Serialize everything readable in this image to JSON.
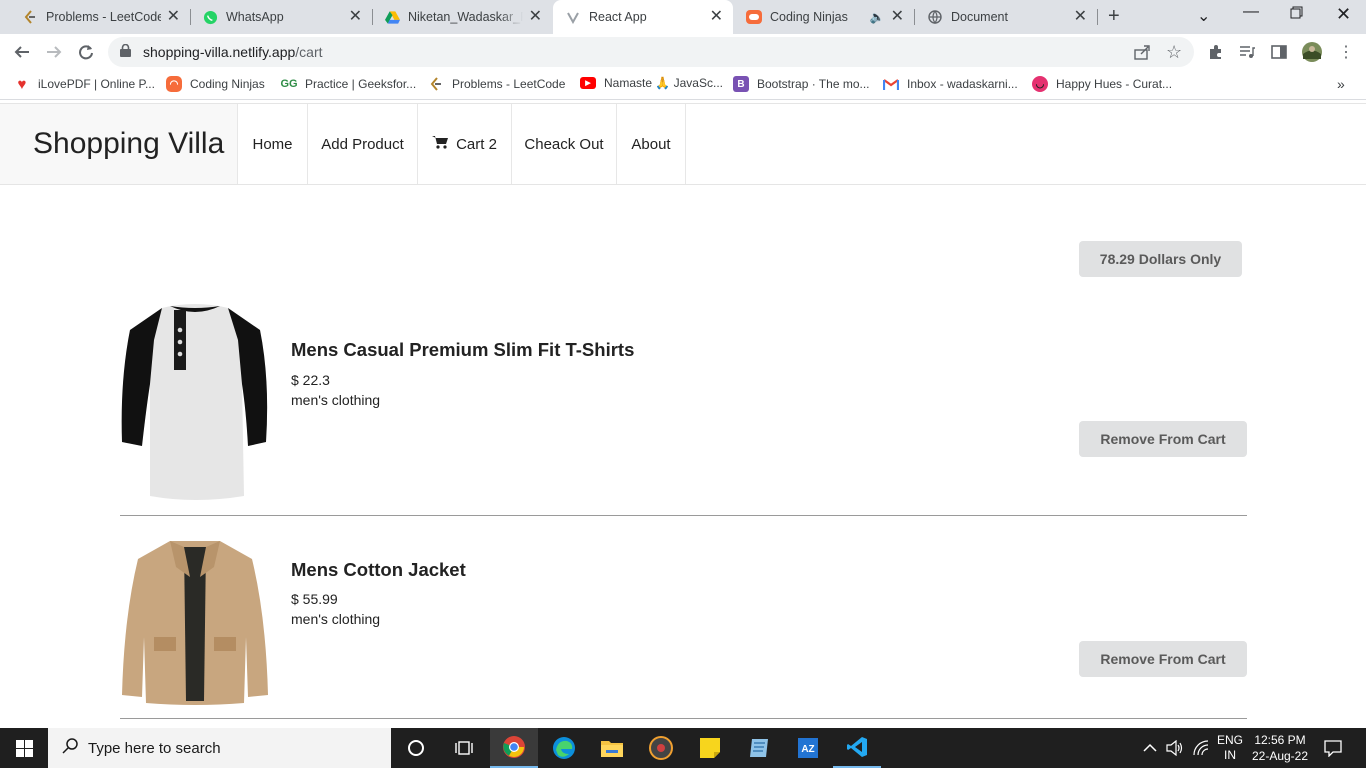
{
  "browser": {
    "tabs": [
      {
        "title": "Problems - LeetCode",
        "icon": "leetcode-icon"
      },
      {
        "title": "WhatsApp",
        "icon": "whatsapp-icon"
      },
      {
        "title": "Niketan_Wadaskar_Re",
        "icon": "google-drive-icon"
      },
      {
        "title": "React App",
        "icon": "react-icon",
        "active": true
      },
      {
        "title": "Coding Ninjas",
        "icon": "coding-ninjas-icon"
      },
      {
        "title": "Document",
        "icon": "globe-icon"
      }
    ],
    "url": {
      "host": "shopping-villa.netlify.app",
      "path": "/cart"
    },
    "bookmarks": [
      {
        "label": "iLovePDF | Online P...",
        "icon": "ilovepdf-icon"
      },
      {
        "label": "Coding Ninjas",
        "icon": "coding-ninjas-icon"
      },
      {
        "label": "Practice | Geeksfor...",
        "icon": "geeksforgeeks-icon"
      },
      {
        "label": "Problems - LeetCode",
        "icon": "leetcode-icon"
      },
      {
        "label": "Namaste 🙏 JavaSc...",
        "icon": "youtube-icon"
      },
      {
        "label": "Bootstrap · The mo...",
        "icon": "bootstrap-icon"
      },
      {
        "label": "Inbox - wadaskarni...",
        "icon": "gmail-icon"
      },
      {
        "label": "Happy Hues - Curat...",
        "icon": "happy-hues-icon"
      }
    ]
  },
  "app": {
    "brand": "Shopping Villa",
    "nav": {
      "home": "Home",
      "add_product": "Add Product",
      "cart": "Cart 2",
      "checkout": "Cheack Out",
      "about": "About"
    },
    "total": "78.29 Dollars Only",
    "cart_items": [
      {
        "title": "Mens Casual Premium Slim Fit T-Shirts",
        "price": "$ 22.3",
        "category": "men's clothing",
        "remove_label": "Remove From Cart",
        "image": "tshirt-image"
      },
      {
        "title": "Mens Cotton Jacket",
        "price": "$ 55.99",
        "category": "men's clothing",
        "remove_label": "Remove From Cart",
        "image": "jacket-image"
      }
    ]
  },
  "taskbar": {
    "search_placeholder": "Type here to search",
    "lang_top": "ENG",
    "lang_bottom": "IN",
    "time": "12:56 PM",
    "date": "22-Aug-22"
  },
  "colors": {
    "tab_strip": "#dee1e6",
    "button_bg": "#e0e1e2",
    "taskbar": "#1f1f1f"
  }
}
